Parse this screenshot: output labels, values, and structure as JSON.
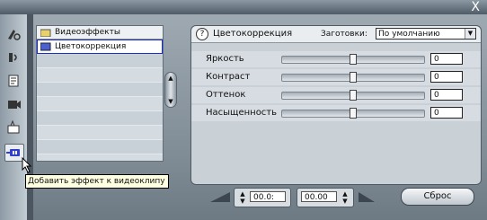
{
  "window": {
    "close_symbol": "X"
  },
  "toolbar": {
    "tools": [
      "clip-properties-icon",
      "audio-icon",
      "titles-icon",
      "camera-icon",
      "disc-icon",
      "video-effects-icon"
    ]
  },
  "effects_list": {
    "header": "Видеоэффекты",
    "items": [
      "Цветокоррекция"
    ]
  },
  "tooltip": "Добавить эффект к видеоклипу",
  "panel": {
    "title": "Цветокоррекция",
    "preset_label": "Заготовки:",
    "preset_value": "По умолчанию",
    "sliders": [
      {
        "label": "Яркость",
        "value": "0",
        "level": 0.5
      },
      {
        "label": "Контраст",
        "value": "0",
        "level": 0.5
      },
      {
        "label": "Оттенок",
        "value": "0",
        "level": 0.5
      },
      {
        "label": "Насыщенность",
        "value": "0",
        "level": 0.5
      }
    ]
  },
  "bottom": {
    "timecode_start": "00.0:",
    "timecode_end": "00.00",
    "reset_label": "Сброс"
  },
  "colors": {
    "selection_outline": "#1a2bd1",
    "tooltip_bg": "#ffffe1"
  }
}
